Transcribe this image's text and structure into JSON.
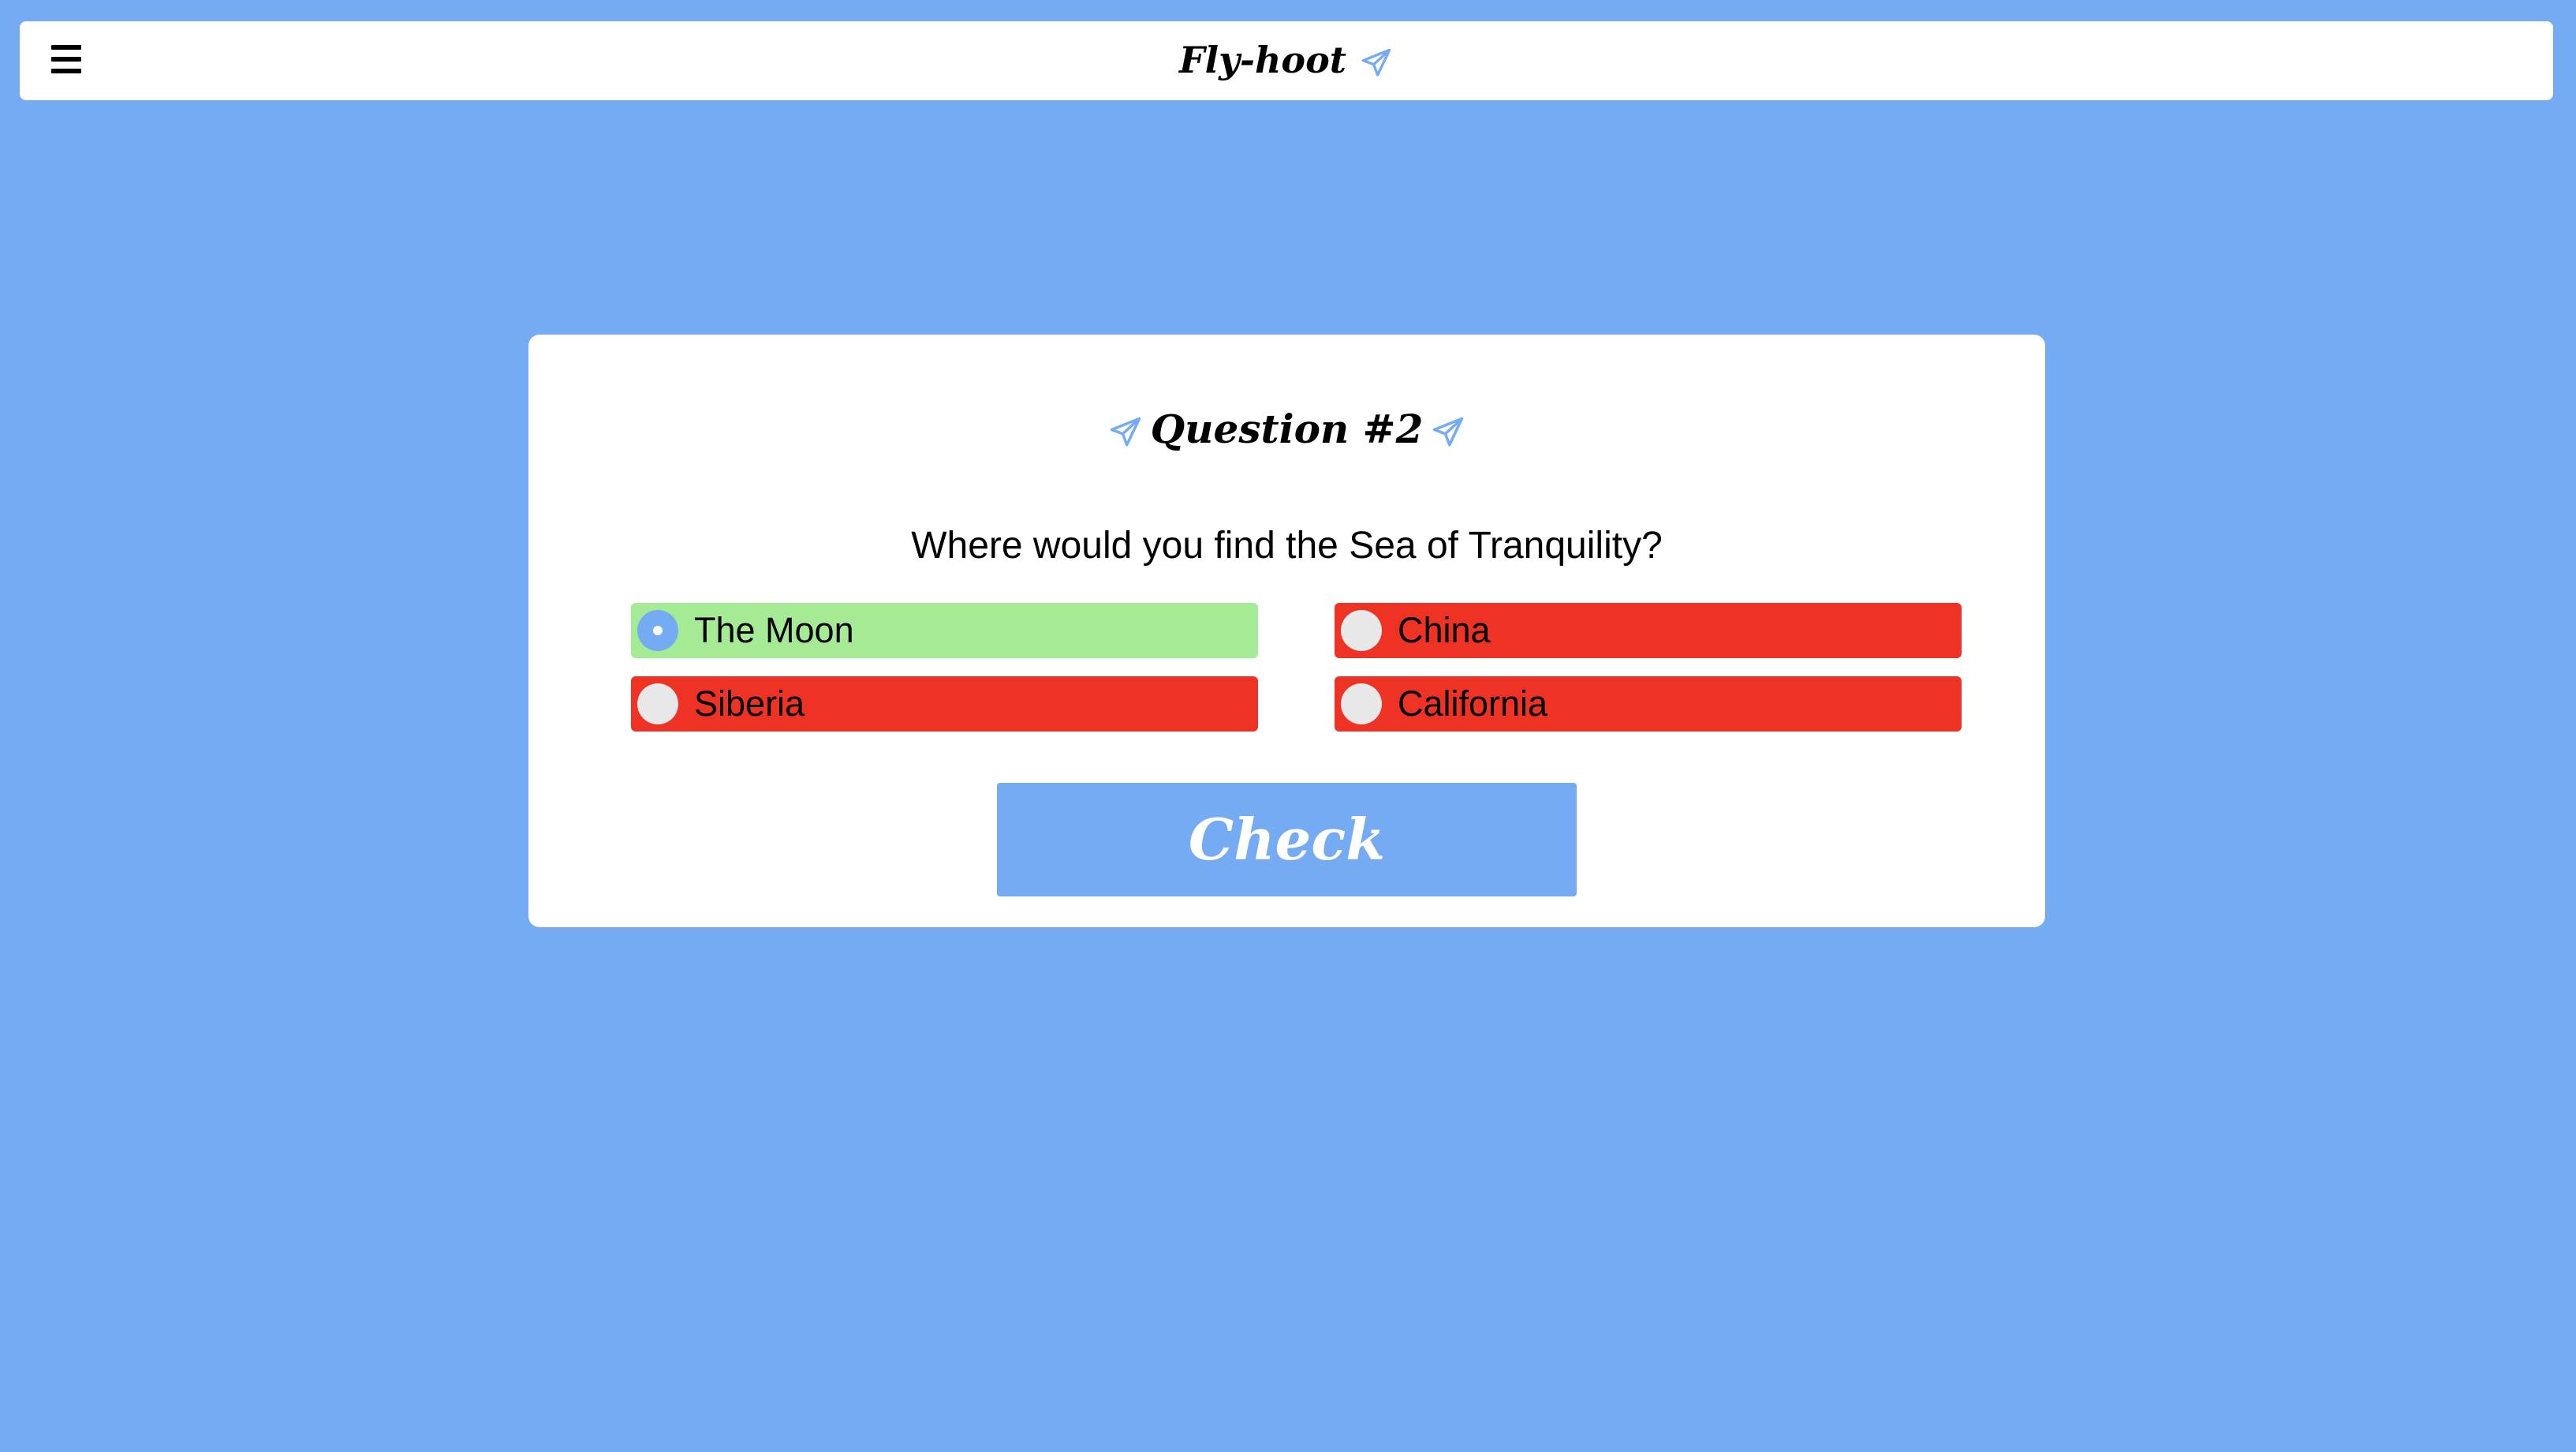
{
  "navbar": {
    "menu_icon": "hamburger-menu-icon",
    "brand": "Fly-hoot",
    "brand_icon": "paper-plane-icon"
  },
  "quiz": {
    "title": "Question #2",
    "title_icons": [
      "paper-plane-icon",
      "paper-plane-icon"
    ],
    "question": "Where would you find the Sea of Tranquility?",
    "options": [
      {
        "label": "The Moon",
        "selected": true,
        "status": "correct"
      },
      {
        "label": "China",
        "selected": false,
        "status": "wrong"
      },
      {
        "label": "Siberia",
        "selected": false,
        "status": "wrong"
      },
      {
        "label": "California",
        "selected": false,
        "status": "wrong"
      }
    ],
    "check_label": "Check"
  },
  "colors": {
    "background": "#74abf3",
    "correct": "#a5ea95",
    "wrong": "#ee3224",
    "accent": "#74abf3"
  }
}
